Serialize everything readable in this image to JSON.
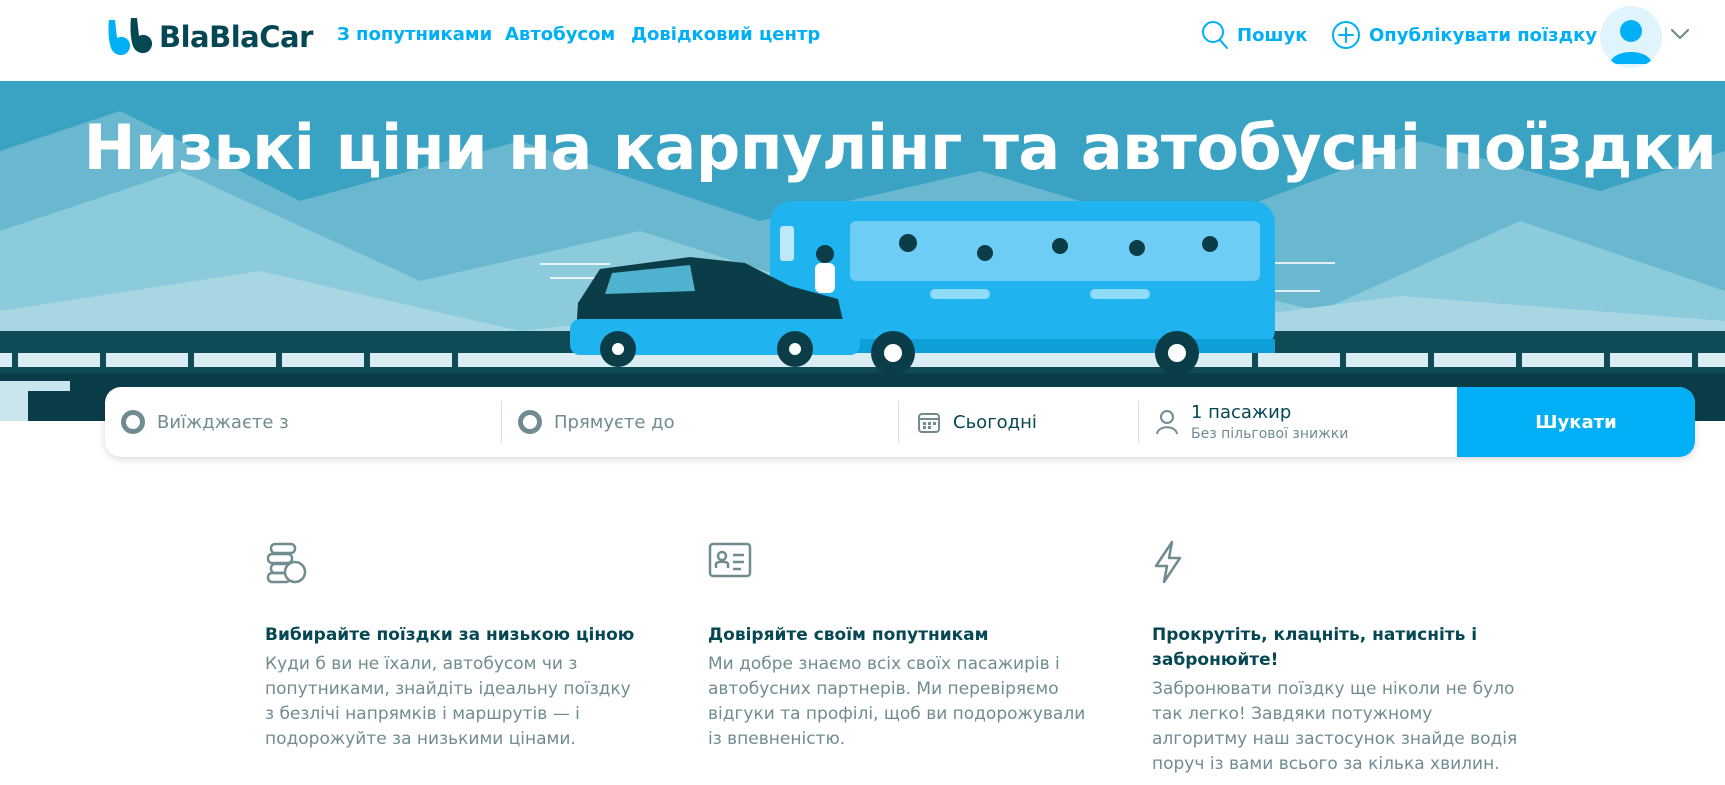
{
  "header": {
    "logo_text": "BlaBlaCar",
    "nav": [
      {
        "label": "З попутниками"
      },
      {
        "label": "Автобусом"
      },
      {
        "label": "Довідковий центр"
      }
    ],
    "search_label": "Пошук",
    "publish_label": "Опублікувати поїздку",
    "icons": {
      "search": "search-icon",
      "publish": "plus-circle-icon",
      "avatar": "user-avatar-icon",
      "menu": "chevron-down-icon"
    }
  },
  "hero": {
    "title": "Низькі ціни на карпулінг та автобусні поїздки"
  },
  "search": {
    "from_placeholder": "Виїжджаєте з",
    "to_placeholder": "Прямуєте до",
    "date_value": "Сьогодні",
    "passengers_main": "1 пасажир",
    "passengers_sub": "Без пільгової знижки",
    "button_label": "Шукати"
  },
  "features": [
    {
      "icon": "coins-icon",
      "title": "Вибирайте поїздки за низькою ціною",
      "text": "Куди б ви не їхали, автобусом чи з попутниками, знайдіть ідеальну поїздку з безлічі напрямків і маршрутів — і подорожуйте за низькими цінами."
    },
    {
      "icon": "id-card-icon",
      "title": "Довіряйте своїм попутникам",
      "text": "Ми добре знаємо всіх своїх пасажирів і автобусних партнерів. Ми перевіряємо відгуки та профілі, щоб ви подорожували із впевненістю."
    },
    {
      "icon": "lightning-icon",
      "title": "Прокрутіть, клацніть, натисніть і забронюйте!",
      "text": "Забронювати поїздку ще ніколи не було так легко! Завдяки потужному алгоритму наш застосунок знайде водія поруч із вами всього за кілька хвилин."
    }
  ],
  "colors": {
    "brand_blue": "#00aff5",
    "dark_teal": "#054752",
    "muted_gray": "#708c91"
  }
}
